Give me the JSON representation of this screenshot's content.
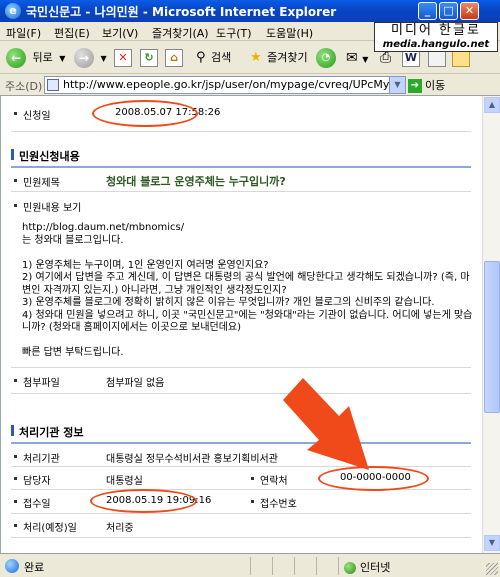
{
  "window": {
    "title": "국민신문고 - 나의민원 - Microsoft Internet Explorer",
    "min": "_",
    "max": "□",
    "close": "✕"
  },
  "watermark": {
    "main": "미디어 한글로",
    "url": "media.hangulo.net"
  },
  "menu": [
    "파일(F)",
    "편집(E)",
    "보기(V)",
    "즐겨찾기(A)",
    "도구(T)",
    "도움말(H)"
  ],
  "toolbar": {
    "back_label": "뒤로",
    "search_label": "검색",
    "favorites_label": "즐겨찾기"
  },
  "address": {
    "label": "주소(D)",
    "url": "http://www.epeople.go.kr/jsp/user/on/mypage/cvreq/UPcMyCvreqVie",
    "go_label": "이동"
  },
  "content": {
    "submit_date_label": "신청일",
    "submit_date": "2008.05.07 17:58:26",
    "section_request": "민원신청내용",
    "subject_label": "민원제목",
    "subject": "청와대 블로그 운영주체는 누구입니까?",
    "body_label": "민원내용 보기",
    "body_text": "http://blog.daum.net/mbnomics/\n는 청와대 블로그입니다.\n\n1) 운영주체는 누구이며, 1인 운영인지 여러명 운영인지요?\n2) 여기에서 답변을 주고 계신데, 이 답변은 대통령의 공식 발언에 해당한다고 생각해도 되겠습니까? (즉, 마변인 자격까지 있는지.) 아니라면, 그냥 개인적인 생각정도인지?\n3) 운영주체를 블로그에 정확히 밝히지 않은 이유는 무엇입니까? 개인 블로그의 신비주의 같습니다.\n4) 청와대 민원을 넣으려고 하니, 이곳 \"국민신문고\"에는 \"청와대\"라는 기관이 없습니다. 어디에 넣는게 맞습니까? (청와대 홈페이지에서는 이곳으로 보내던데요)\n\n빠른 답변 부탁드립니다.",
    "attachment_label": "첨부파일",
    "attachment": "첨부파일 없음",
    "section_agency": "처리기관 정보",
    "agency_label": "처리기관",
    "agency": "대통령실 정무수석비서관 홍보기획비서관",
    "manager_label": "담당자",
    "manager": "대통령실",
    "contact_label": "연락처",
    "contact": "00-0000-0000",
    "received_label": "접수일",
    "received": "2008.05.19 19:09:16",
    "receipt_no_label": "접수번호",
    "process_label": "처리(예정)일",
    "process": "처리중"
  },
  "status": {
    "text": "완료",
    "zone": "인터넷"
  },
  "colors": {
    "annotation": "#f04a1a",
    "subject": "#2a5a1e",
    "section_bar": "#2c5ab3"
  }
}
